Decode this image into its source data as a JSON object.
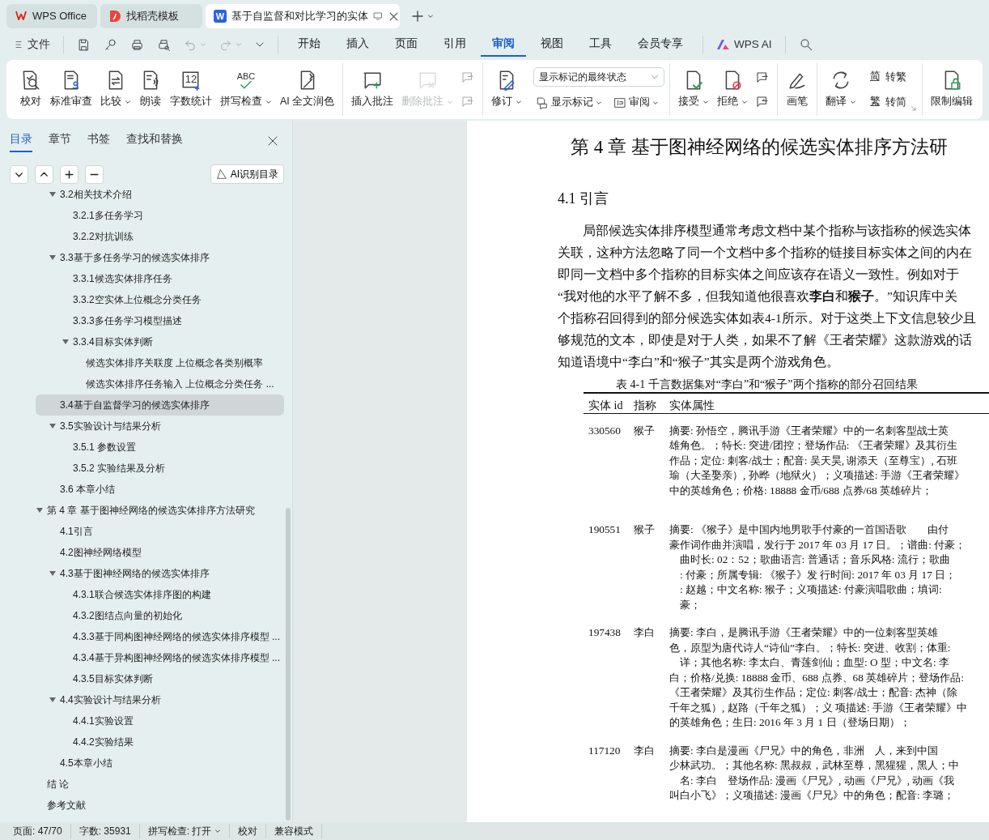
{
  "app_tabs": [
    {
      "kind": "home",
      "label": "WPS Office",
      "selected": false
    },
    {
      "kind": "template",
      "label": "找稻壳模板",
      "selected": false
    },
    {
      "kind": "document",
      "label": "基于自监督和对比学习的实体",
      "icon_text": "W",
      "selected": true
    }
  ],
  "quick_menu": {
    "label": "文件"
  },
  "menu_tabs": [
    {
      "label": "开始",
      "selected": false
    },
    {
      "label": "插入",
      "selected": false
    },
    {
      "label": "页面",
      "selected": false
    },
    {
      "label": "引用",
      "selected": false
    },
    {
      "label": "审阅",
      "selected": true
    },
    {
      "label": "视图",
      "selected": false
    },
    {
      "label": "工具",
      "selected": false
    },
    {
      "label": "会员专享",
      "selected": false
    }
  ],
  "ai_button": {
    "label": "WPS AI"
  },
  "ribbon": [
    {
      "items": [
        {
          "kind": "large",
          "label": "校对",
          "caret": false,
          "disabled": false
        },
        {
          "kind": "large",
          "label": "标准审查",
          "caret": false,
          "disabled": false
        },
        {
          "kind": "large",
          "label": "比较",
          "caret": true,
          "disabled": false
        },
        {
          "kind": "large",
          "label": "朗读",
          "caret": false,
          "disabled": false
        },
        {
          "kind": "large",
          "label": "字数统计",
          "icon_text": "12",
          "caret": false,
          "disabled": false
        },
        {
          "kind": "large",
          "label": "拼写检查",
          "icon_text": "ABC",
          "caret": true,
          "disabled": false
        },
        {
          "kind": "large",
          "label": "AI 全文润色",
          "caret": false,
          "disabled": false
        }
      ]
    },
    {
      "items": [
        {
          "kind": "large",
          "label": "插入批注",
          "caret": false,
          "disabled": false
        },
        {
          "kind": "large",
          "label": "删除批注",
          "caret": true,
          "disabled": true
        },
        {
          "kind": "iconpair",
          "disabled": true
        }
      ]
    },
    {
      "items": [
        {
          "kind": "large",
          "label": "修订",
          "caret": true,
          "disabled": false
        },
        {
          "kind": "stack",
          "select": "显示标记的最终状态",
          "row": [
            {
              "label": "显示标记",
              "caret": true,
              "disabled": false
            },
            {
              "label": "审阅",
              "caret": true,
              "disabled": false
            }
          ]
        }
      ]
    },
    {
      "items": [
        {
          "kind": "large",
          "label": "接受",
          "caret": true,
          "disabled": false
        },
        {
          "kind": "large",
          "label": "拒绝",
          "caret": true,
          "disabled": false
        },
        {
          "kind": "iconpair",
          "disabled": false
        }
      ]
    },
    {
      "items": [
        {
          "kind": "large",
          "label": "画笔",
          "caret": false,
          "disabled": false
        }
      ]
    },
    {
      "items": [
        {
          "kind": "large",
          "label": "翻译",
          "caret": true,
          "disabled": false
        },
        {
          "kind": "convert",
          "row": [
            {
              "label": "转繁",
              "icon_text": "简",
              "disabled": false
            },
            {
              "label": "转简",
              "icon_text": "繁",
              "disabled": false
            }
          ]
        }
      ]
    },
    {
      "items": [
        {
          "kind": "large",
          "label": "限制编辑",
          "caret": false,
          "disabled": false
        }
      ]
    }
  ],
  "sidebar": {
    "tabs": [
      {
        "label": "目录",
        "selected": true
      },
      {
        "label": "章节",
        "selected": false
      },
      {
        "label": "书签",
        "selected": false
      },
      {
        "label": "查找和替换",
        "selected": false
      }
    ],
    "ai_button": {
      "label": "AI识别目录"
    },
    "outline": {
      "continued_items": [
        {
          "label": "3.2相关技术介绍",
          "selected": false,
          "expanded": true,
          "children": [
            {
              "label": "3.2.1多任务学习",
              "selected": false
            },
            {
              "label": "3.2.2对抗训练",
              "selected": false
            }
          ]
        },
        {
          "label": "3.3基于多任务学习的候选实体排序",
          "selected": false,
          "expanded": true,
          "children": [
            {
              "label": "3.3.1候选实体排序任务",
              "selected": false
            },
            {
              "label": "3.3.2空实体上位概念分类任务",
              "selected": false
            },
            {
              "label": "3.3.3多任务学习模型描述",
              "selected": false
            },
            {
              "label": "3.3.4目标实体判断",
              "selected": false,
              "expanded": true,
              "children": [
                {
                  "label": "候选实体排序关联度 上位概念各类别概率",
                  "selected": false
                },
                {
                  "label": "候选实体排序任务输入 上位概念分类任务 ...",
                  "selected": false
                }
              ]
            }
          ]
        },
        {
          "label": "3.4基于自监督学习的候选实体排序",
          "selected": true
        },
        {
          "label": "3.5实验设计与结果分析",
          "selected": false,
          "expanded": true,
          "children": [
            {
              "label": "3.5.1 参数设置",
              "selected": false
            },
            {
              "label": "3.5.2 实验结果及分析",
              "selected": false
            }
          ]
        },
        {
          "label": "3.6 本章小结",
          "selected": false
        }
      ],
      "items": [
        {
          "label": "第 4 章 基于图神经网络的候选实体排序方法研究",
          "selected": false,
          "expanded": true,
          "children": [
            {
              "label": "4.1引言",
              "selected": false
            },
            {
              "label": "4.2图神经网络模型",
              "selected": false
            },
            {
              "label": "4.3基于图神经网络的候选实体排序",
              "selected": false,
              "expanded": true,
              "children": [
                {
                  "label": "4.3.1联合候选实体排序图的构建",
                  "selected": false
                },
                {
                  "label": "4.3.2图结点向量的初始化",
                  "selected": false
                },
                {
                  "label": "4.3.3基于同构图神经网络的候选实体排序模型 ...",
                  "selected": false
                },
                {
                  "label": "4.3.4基于异构图神经网络的候选实体排序模型 ...",
                  "selected": false
                },
                {
                  "label": "4.3.5目标实体判断",
                  "selected": false
                }
              ]
            },
            {
              "label": "4.4实验设计与结果分析",
              "selected": false,
              "expanded": true,
              "children": [
                {
                  "label": "4.4.1实验设置",
                  "selected": false
                },
                {
                  "label": "4.4.2实验结果",
                  "selected": false
                }
              ]
            },
            {
              "label": "4.5本章小结",
              "selected": false
            }
          ]
        },
        {
          "label": "结 论",
          "selected": false
        },
        {
          "label": "参考文献",
          "selected": false
        }
      ]
    }
  },
  "document": {
    "chapter_title": "第 4 章  基于图神经网络的候选实体排序方法研",
    "section_title": "4.1  引言",
    "paragraph": [
      "局部候选实体排序模型通常考虑文档中某个指称与该指称的候选实体",
      "关联，这种方法忽略了同一个文档中多个指称的链接目标实体之间的内在",
      "即同一文档中多个指称的目标实体之间应该存在语义一致性。例如对于",
      "“我对他的水平了解不多，但我知道他很喜欢**李白**和**猴子**。”知识库中关",
      "个指称召回得到的部分候选实体如表4-1所示。对于这类上下文信息较少且",
      "够规范的文本，即使是对于人类，如果不了解《王者荣耀》这款游戏的话",
      "知道语境中“李白”和“猴子”其实是两个游戏角色。"
    ],
    "table": {
      "caption": "表 4-1 千言数据集对“李白”和“猴子”两个指称的部分召回结果",
      "columns": [
        "实体 id",
        "指称",
        "实体属性"
      ],
      "rows": [
        {
          "id": "330560",
          "mention": "猴子",
          "attributes": [
            "摘要: 孙悟空，腾讯手游《王者荣耀》中的一名刺客型战士英",
            "雄角色。；特长: 突进/团控；登场作品: 《王者荣耀》及其衍生",
            "作品；定位: 刺客/战士；配音: 吴天昊, 谢添天（至尊宝）, 石班",
            "瑜（大圣娶亲）, 孙晔（地狱火）；义项描述: 手游《王者荣耀》",
            "中的英雄角色；价格: 18888 金币/688 点券/68 英雄碎片；"
          ]
        },
        {
          "id": "190551",
          "mention": "猴子",
          "attributes": [
            "摘要: 《猴子》是中国内地男歌手付豪的一首国语歌　　由付",
            "豪作词作曲并演唱，发行于 2017 年 03 月 17 日。；谱曲: 付豪；",
            "　曲时长: 02：52；歌曲语言: 普通话；音乐风格: 流行；歌曲",
            "　: 付豪；所属专辑: 《猴子》发 行时间: 2017 年 03 月 17 日；",
            "　: 赵越；中文名称: 猴子；义项描述: 付豪演唱歌曲；填词:",
            "　豪；"
          ]
        },
        {
          "id": "197438",
          "mention": "李白",
          "attributes": [
            "摘要: 李白，是腾讯手游《王者荣耀》中的一位刺客型英雄",
            "色，原型为唐代诗人“诗仙”李白。；特长: 突进、收割；体重:",
            "　详；其他名称: 李太白、青莲剑仙；血型: O 型；中文名: 李",
            "白；价格/兑换: 18888 金币、688 点券、68 英雄碎片；登场作品:",
            "《王者荣耀》及其衍生作品；定位: 刺客/战士；配音: 杰神（除",
            "千年之狐）, 赵路（千年之狐）；义 项描述: 手游《王者荣耀》中",
            "的英雄角色；生日: 2016 年 3 月 1 日（登场日期）；"
          ]
        },
        {
          "id": "117120",
          "mention": "李白",
          "attributes": [
            "摘要: 李白是漫画《尸兄》中的角色，非洲　人，来到中国",
            "少林武功。；其他名称: 黑叔叔，武林至尊，黑猩猩，黑人；中",
            "　名: 李白　登场作品: 漫画《尸兄》, 动画《尸兄》, 动画《我",
            "叫白小飞》；义项描述: 漫画《尸兄》中的角色；配音: 李璐；"
          ]
        }
      ]
    }
  },
  "status_bar": [
    {
      "label": "页面: 47/70",
      "caret": false
    },
    {
      "label": "字数: 35931",
      "caret": false
    },
    {
      "label": "拼写检查: 打开",
      "caret": true
    },
    {
      "label": "校对",
      "caret": false
    },
    {
      "label": "兼容模式",
      "caret": false
    }
  ]
}
